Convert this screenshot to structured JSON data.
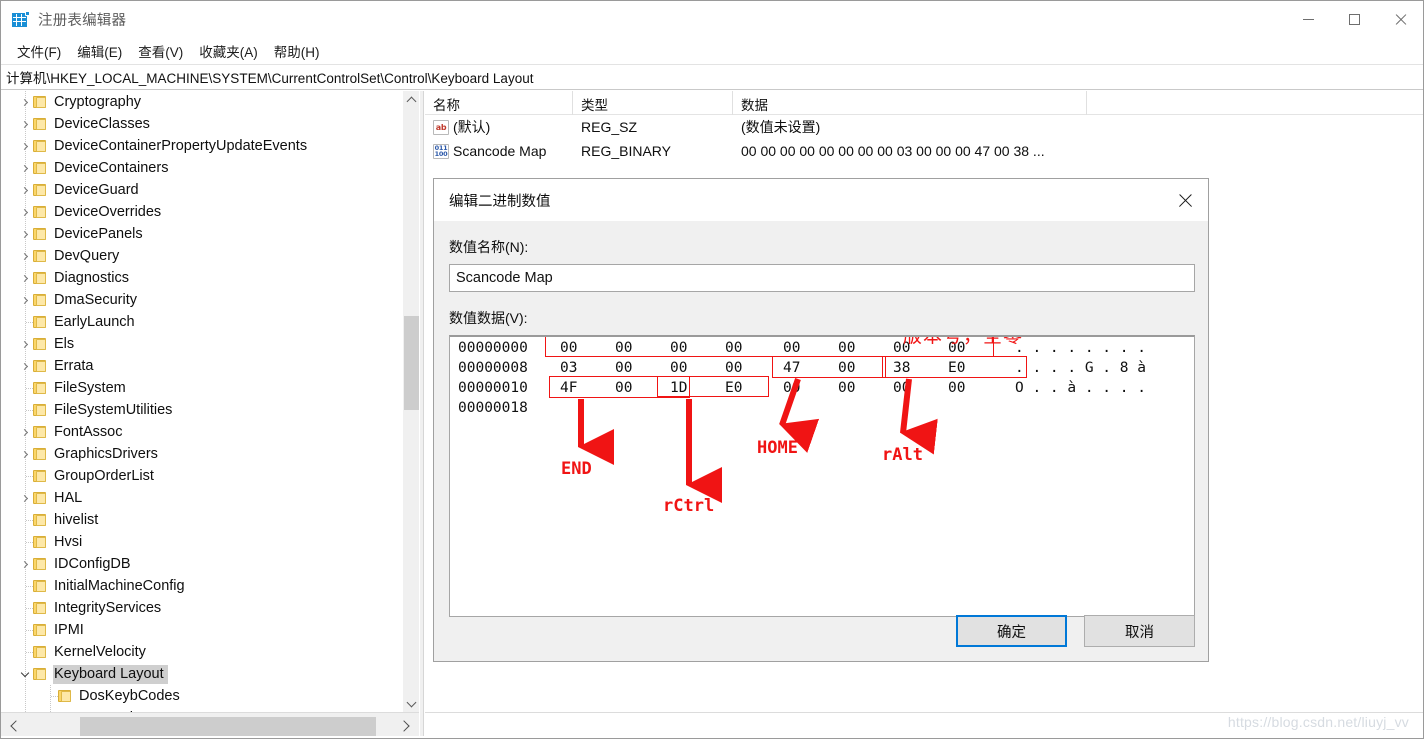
{
  "window": {
    "title": "注册表编辑器",
    "icon": "registry-editor-icon",
    "controls": {
      "minimize": "minimize-icon",
      "maximize": "maximize-icon",
      "close": "close-icon"
    }
  },
  "menubar": {
    "items": [
      {
        "label": "文件(F)",
        "name": "menu-file"
      },
      {
        "label": "编辑(E)",
        "name": "menu-edit"
      },
      {
        "label": "查看(V)",
        "name": "menu-view"
      },
      {
        "label": "收藏夹(A)",
        "name": "menu-favorites"
      },
      {
        "label": "帮助(H)",
        "name": "menu-help"
      }
    ]
  },
  "address": {
    "path": "计算机\\HKEY_LOCAL_MACHINE\\SYSTEM\\CurrentControlSet\\Control\\Keyboard Layout"
  },
  "tree": {
    "items": [
      {
        "label": "Cryptography",
        "indent": 1,
        "expandable": true,
        "expanded": false,
        "selected": false
      },
      {
        "label": "DeviceClasses",
        "indent": 1,
        "expandable": true,
        "expanded": false,
        "selected": false
      },
      {
        "label": "DeviceContainerPropertyUpdateEvents",
        "indent": 1,
        "expandable": true,
        "expanded": false,
        "selected": false
      },
      {
        "label": "DeviceContainers",
        "indent": 1,
        "expandable": true,
        "expanded": false,
        "selected": false
      },
      {
        "label": "DeviceGuard",
        "indent": 1,
        "expandable": true,
        "expanded": false,
        "selected": false
      },
      {
        "label": "DeviceOverrides",
        "indent": 1,
        "expandable": true,
        "expanded": false,
        "selected": false
      },
      {
        "label": "DevicePanels",
        "indent": 1,
        "expandable": true,
        "expanded": false,
        "selected": false
      },
      {
        "label": "DevQuery",
        "indent": 1,
        "expandable": true,
        "expanded": false,
        "selected": false
      },
      {
        "label": "Diagnostics",
        "indent": 1,
        "expandable": true,
        "expanded": false,
        "selected": false
      },
      {
        "label": "DmaSecurity",
        "indent": 1,
        "expandable": true,
        "expanded": false,
        "selected": false
      },
      {
        "label": "EarlyLaunch",
        "indent": 1,
        "expandable": false,
        "expanded": false,
        "selected": false
      },
      {
        "label": "Els",
        "indent": 1,
        "expandable": true,
        "expanded": false,
        "selected": false
      },
      {
        "label": "Errata",
        "indent": 1,
        "expandable": true,
        "expanded": false,
        "selected": false
      },
      {
        "label": "FileSystem",
        "indent": 1,
        "expandable": false,
        "expanded": false,
        "selected": false
      },
      {
        "label": "FileSystemUtilities",
        "indent": 1,
        "expandable": false,
        "expanded": false,
        "selected": false
      },
      {
        "label": "FontAssoc",
        "indent": 1,
        "expandable": true,
        "expanded": false,
        "selected": false
      },
      {
        "label": "GraphicsDrivers",
        "indent": 1,
        "expandable": true,
        "expanded": false,
        "selected": false
      },
      {
        "label": "GroupOrderList",
        "indent": 1,
        "expandable": false,
        "expanded": false,
        "selected": false
      },
      {
        "label": "HAL",
        "indent": 1,
        "expandable": true,
        "expanded": false,
        "selected": false
      },
      {
        "label": "hivelist",
        "indent": 1,
        "expandable": false,
        "expanded": false,
        "selected": false
      },
      {
        "label": "Hvsi",
        "indent": 1,
        "expandable": false,
        "expanded": false,
        "selected": false
      },
      {
        "label": "IDConfigDB",
        "indent": 1,
        "expandable": true,
        "expanded": false,
        "selected": false
      },
      {
        "label": "InitialMachineConfig",
        "indent": 1,
        "expandable": false,
        "expanded": false,
        "selected": false
      },
      {
        "label": "IntegrityServices",
        "indent": 1,
        "expandable": false,
        "expanded": false,
        "selected": false
      },
      {
        "label": "IPMI",
        "indent": 1,
        "expandable": false,
        "expanded": false,
        "selected": false
      },
      {
        "label": "KernelVelocity",
        "indent": 1,
        "expandable": false,
        "expanded": false,
        "selected": false
      },
      {
        "label": "Keyboard Layout",
        "indent": 1,
        "expandable": true,
        "expanded": true,
        "selected": true
      },
      {
        "label": "DosKeybCodes",
        "indent": 2,
        "expandable": false,
        "expanded": false,
        "selected": false
      },
      {
        "label": "DosKeybIDs",
        "indent": 2,
        "expandable": false,
        "expanded": false,
        "selected": false
      }
    ]
  },
  "values": {
    "columns": [
      "名称",
      "类型",
      "数据"
    ],
    "rows": [
      {
        "icon": "string-value-icon",
        "name": "(默认)",
        "type": "REG_SZ",
        "data": "(数值未设置)"
      },
      {
        "icon": "binary-value-icon",
        "name": "Scancode Map",
        "type": "REG_BINARY",
        "data": "00 00 00 00 00 00 00 00 03 00 00 00 47 00 38 ..."
      }
    ]
  },
  "dialog": {
    "title": "编辑二进制数值",
    "close_icon": "close-icon",
    "name_label": "数值名称(N):",
    "name_value": "Scancode Map",
    "name_placeholder": "",
    "data_label": "数值数据(V):",
    "ok_label": "确定",
    "cancel_label": "取消",
    "hex": {
      "offsets": [
        "00000000",
        "00000008",
        "00000010",
        "00000018"
      ],
      "rows": [
        {
          "offset": "00000000",
          "bytes": [
            "00",
            "00",
            "00",
            "00",
            "00",
            "00",
            "00",
            "00"
          ],
          "ascii": ". . . . . . . ."
        },
        {
          "offset": "00000008",
          "bytes": [
            "03",
            "00",
            "00",
            "00",
            "47",
            "00",
            "38",
            "E0"
          ],
          "ascii": ". . . . G . 8 à"
        },
        {
          "offset": "00000010",
          "bytes": [
            "4F",
            "00",
            "1D",
            "E0",
            "00",
            "00",
            "00",
            "00"
          ],
          "ascii": "O . . à . . . ."
        },
        {
          "offset": "00000018",
          "bytes": [],
          "ascii": ""
        }
      ]
    },
    "annotations": [
      {
        "name": "annotation-version-zero",
        "text": "版本号，全零",
        "kind": "cn"
      },
      {
        "name": "annotation-end",
        "text": "END",
        "kind": "mono"
      },
      {
        "name": "annotation-rctrl",
        "text": "rCtrl",
        "kind": "mono"
      },
      {
        "name": "annotation-home",
        "text": "HOME",
        "kind": "mono"
      },
      {
        "name": "annotation-ralt",
        "text": "rAlt",
        "kind": "mono"
      }
    ],
    "annotation_color": "#f01414"
  },
  "watermark": {
    "text": "https://blog.csdn.net/liuyj_vv"
  }
}
